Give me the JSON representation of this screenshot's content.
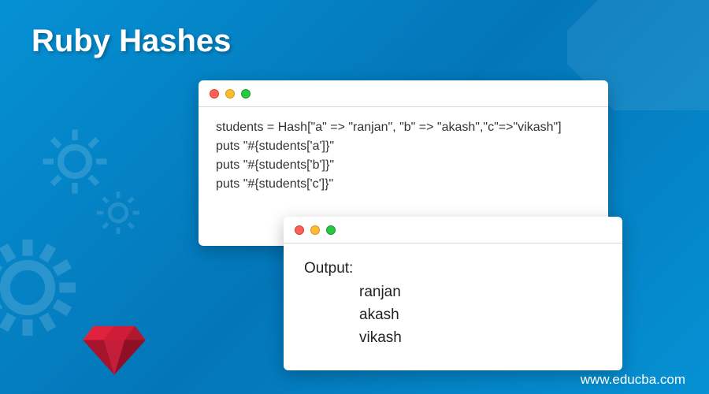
{
  "title": "Ruby Hashes",
  "code": {
    "line1": "students = Hash[\"a\" => \"ranjan\", \"b\" => \"akash\",\"c\"=>\"vikash\"]",
    "line2": "puts \"#{students['a']}\"",
    "line3": "puts \"#{students['b']}\"",
    "line4": "puts \"#{students['c']}\""
  },
  "output": {
    "label": "Output:",
    "line1": "ranjan",
    "line2": "akash",
    "line3": "vikash"
  },
  "footer": "www.educba.com"
}
